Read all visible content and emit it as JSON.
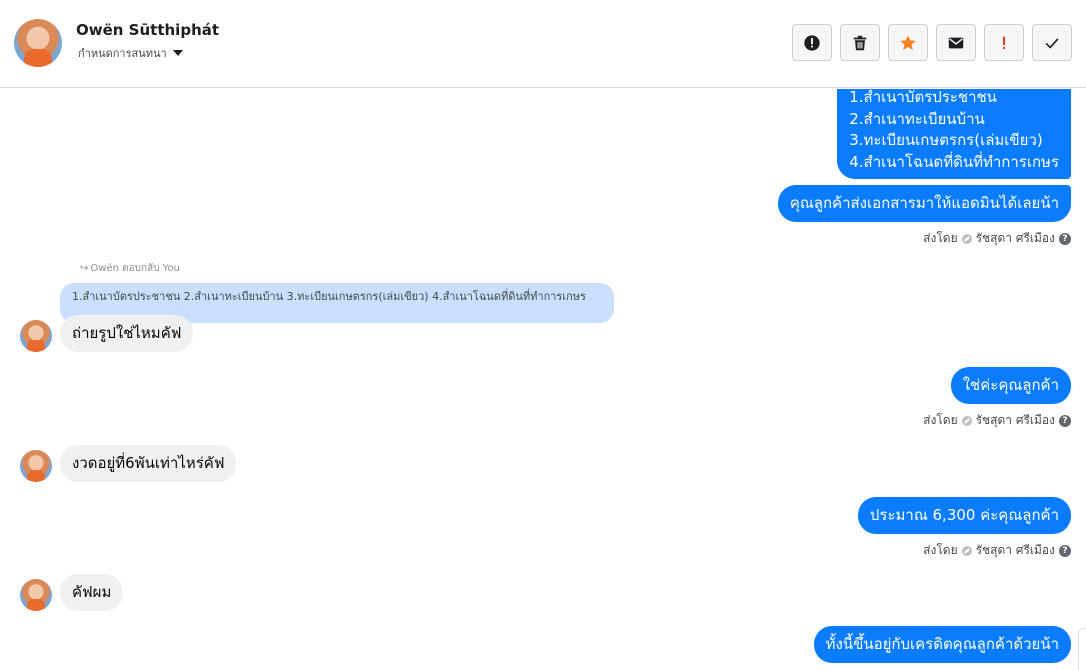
{
  "header": {
    "contact_name": "Owën Sūtthiphát",
    "assign_label": "กำหนดการสนทนา",
    "buttons": [
      {
        "icon": "alert-circle-icon",
        "color": "#1c1e21"
      },
      {
        "icon": "trash-icon",
        "color": "#1c1e21"
      },
      {
        "icon": "star-icon",
        "color": "#f5821f"
      },
      {
        "icon": "envelope-icon",
        "color": "#1c1e21"
      },
      {
        "icon": "exclamation-icon",
        "color": "#e1331b"
      },
      {
        "icon": "check-icon",
        "color": "#1c1e21"
      }
    ]
  },
  "colors": {
    "outgoing_bubble": "#0a7cff",
    "incoming_bubble": "#f0f0f0",
    "quoted_bubble": "#c9dffb"
  },
  "messages": {
    "out_docs_list": [
      "1.สำเนาบัตรประชาชน",
      "2.สำเนาทะเบียนบ้าน",
      "3.ทะเบียนเกษตรกร(เล่มเขียว)",
      "4.สำเนาโฉนดที่ดินที่ทำการเกษร"
    ],
    "out_send_docs": "คุณลูกค้าส่งเอกสารมาให้แอดมินได้เลยน้า",
    "reply_label": "Owën ตอบกลับ You",
    "quoted_text": "1.สำเนาบัตรประชาชน 2.สำเนาทะเบียนบ้าน 3.ทะเบียนเกษตรกร(เล่มเขียว) 4.สำเนาโฉนดที่ดินที่ทำการเกษร",
    "in_photo_question": "ถ่ายรูปใช่ไหมคัฟ",
    "out_yes": "ใช่ค่ะคุณลูกค้า",
    "in_installment": "งวดอยู่ที่6พันเท่าไหร่คัฟ",
    "out_amount": "ประมาณ 6,300  ค่ะคุณลูกค้า",
    "in_ack": "คัฟผม",
    "out_credit": "ทั้งนี้ขึ้นอยู่กับเครดิตคุณลูกค้าด้วยน้า"
  },
  "sent_by": {
    "prefix": "ส่งโดย",
    "agent": "รัชสุดา ศรีเมือง"
  }
}
